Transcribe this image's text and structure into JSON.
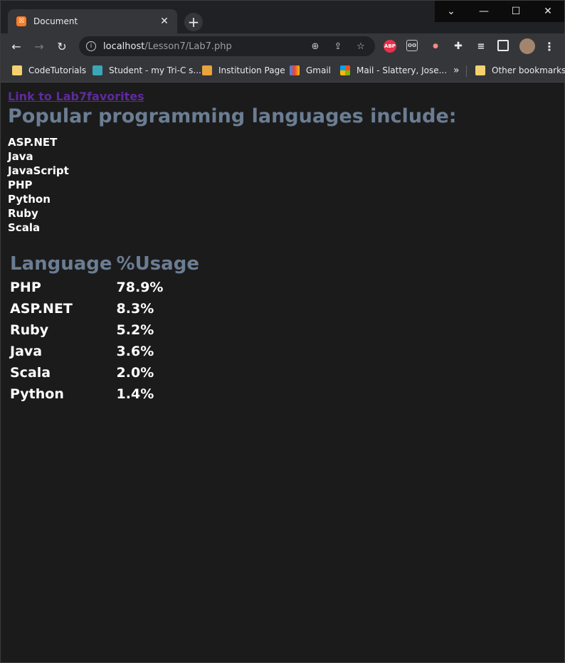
{
  "browser": {
    "tab_title": "Document",
    "tab_favicon": "xampp-icon",
    "new_tab_label": "+",
    "url_host": "localhost",
    "url_path": "/Lesson7/Lab7.php",
    "bookmarks": [
      {
        "label": "CodeTutorials",
        "icon": "folder-icon"
      },
      {
        "label": "Student - my Tri-C s...",
        "icon": "snowflake-icon"
      },
      {
        "label": "Institution Page",
        "icon": "pencil-icon"
      },
      {
        "label": "Gmail",
        "icon": "gmail-icon"
      },
      {
        "label": "Mail - Slattery, Jose...",
        "icon": "microsoft-icon"
      }
    ],
    "bookmarks_overflow": "»",
    "other_bookmarks": "Other bookmarks",
    "abp_label": "ABP"
  },
  "page": {
    "link_text": "Link to Lab7favorites",
    "heading": "Popular programming languages include:",
    "languages": [
      "ASP.NET",
      "Java",
      "JavaScript",
      "PHP",
      "Python",
      "Ruby",
      "Scala"
    ],
    "table": {
      "headers": [
        "Language",
        "%Usage"
      ],
      "rows": [
        [
          "PHP",
          "78.9%"
        ],
        [
          "ASP.NET",
          "8.3%"
        ],
        [
          "Ruby",
          "5.2%"
        ],
        [
          "Java",
          "3.6%"
        ],
        [
          "Scala",
          "2.0%"
        ],
        [
          "Python",
          "1.4%"
        ]
      ]
    }
  },
  "colors": {
    "background": "#1b1b1b",
    "heading": "#6b7d93",
    "link": "#5f2a9e",
    "text": "#ffffff"
  }
}
